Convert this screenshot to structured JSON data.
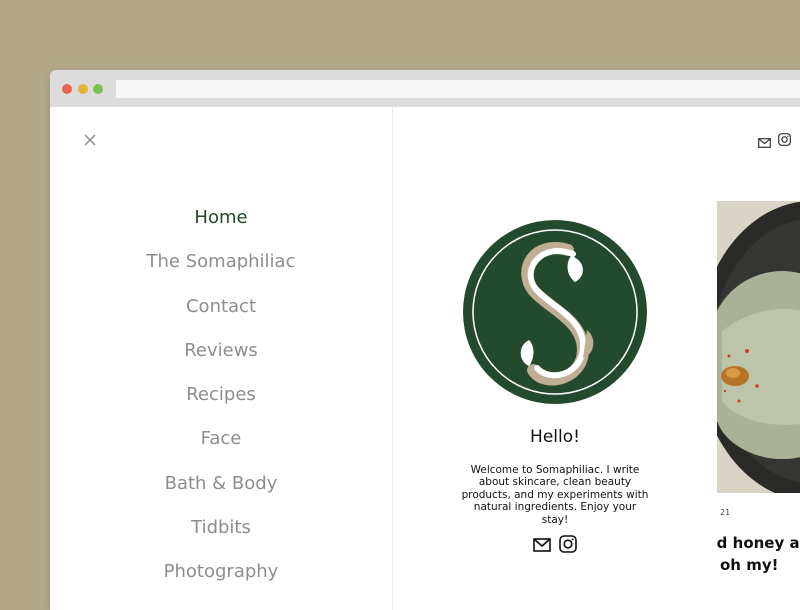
{
  "nav": {
    "items": [
      {
        "label": "Home",
        "active": true
      },
      {
        "label": "The Somaphiliac",
        "active": false
      },
      {
        "label": "Contact",
        "active": false
      },
      {
        "label": "Reviews",
        "active": false
      },
      {
        "label": "Recipes",
        "active": false
      },
      {
        "label": "Face",
        "active": false
      },
      {
        "label": "Bath & Body",
        "active": false
      },
      {
        "label": "Tidbits",
        "active": false
      },
      {
        "label": "Photography",
        "active": false
      }
    ]
  },
  "profile": {
    "greeting": "Hello!",
    "bio": "Welcome to Somaphiliac. I write about skincare, clean beauty products, and my experiments with natural ingredients. Enjoy your stay!"
  },
  "post": {
    "date_fragment": "21",
    "title_line1": "nd honey an",
    "title_line2": "oh my!"
  },
  "icons": {
    "close": "close-icon",
    "email": "email-icon",
    "instagram": "instagram-icon",
    "logo": "somaphiliac-s-logo"
  },
  "colors": {
    "brand_green": "#234a2c",
    "active_nav": "#1f4a28",
    "muted_nav": "#8b8f8b",
    "background": "#b5a88a"
  }
}
